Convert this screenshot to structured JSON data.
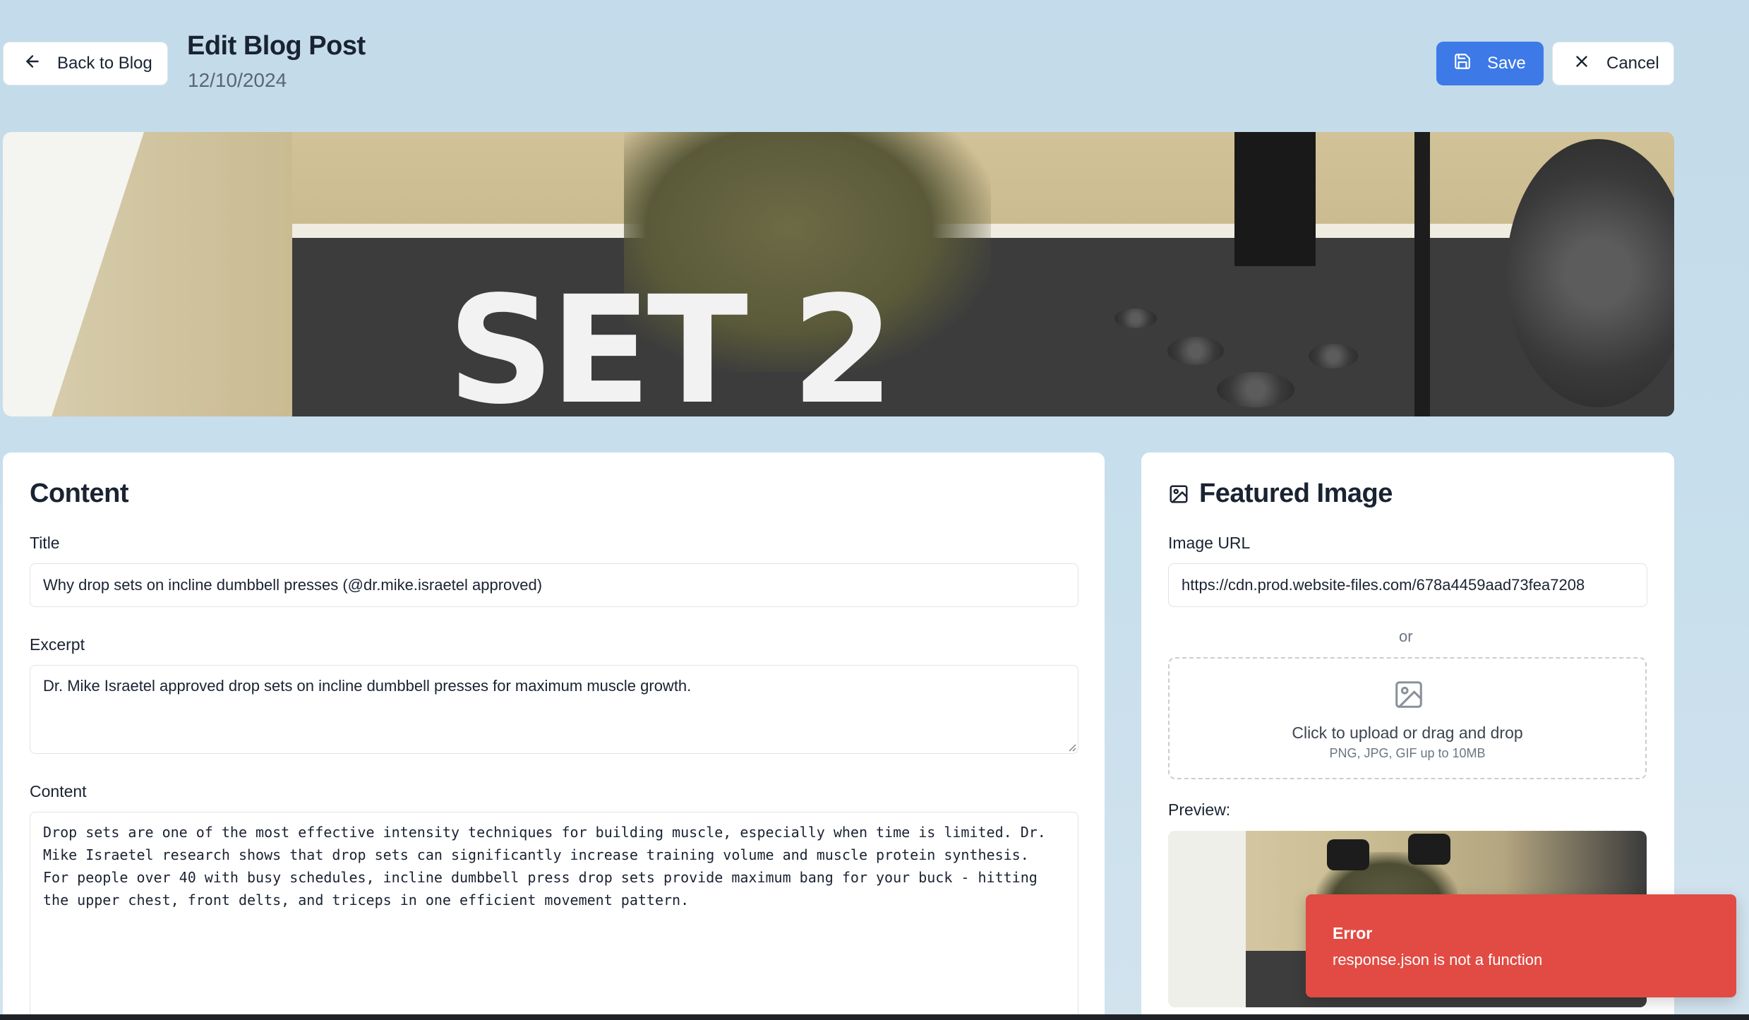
{
  "header": {
    "back_label": "Back to Blog",
    "title": "Edit Blog Post",
    "date": "12/10/2024",
    "save_label": "Save",
    "cancel_label": "Cancel"
  },
  "hero": {
    "overlay_text": "SET 2"
  },
  "content_card": {
    "title": "Content",
    "title_label": "Title",
    "title_value": "Why drop sets on incline dumbbell presses (@dr.mike.israetel approved)",
    "excerpt_label": "Excerpt",
    "excerpt_value": "Dr. Mike Israetel approved drop sets on incline dumbbell presses for maximum muscle growth.",
    "content_label": "Content",
    "content_value": "Drop sets are one of the most effective intensity techniques for building muscle, especially when time is limited. Dr.\nMike Israetel research shows that drop sets can significantly increase training volume and muscle protein synthesis.\nFor people over 40 with busy schedules, incline dumbbell press drop sets provide maximum bang for your buck - hitting\nthe upper chest, front delts, and triceps in one efficient movement pattern."
  },
  "image_card": {
    "title": "Featured Image",
    "url_label": "Image URL",
    "url_value": "https://cdn.prod.website-files.com/678a4459aad73fea7208",
    "or_text": "or",
    "upload_main": "Click to upload or drag and drop",
    "upload_sub": "PNG, JPG, GIF up to 10MB",
    "preview_label": "Preview:"
  },
  "toast": {
    "title": "Error",
    "message": "response.json is not a function"
  },
  "colors": {
    "accent": "#3d7ae8",
    "error": "#e14b43",
    "background": "#c3dbea"
  },
  "icons": [
    "arrow-left-icon",
    "save-icon",
    "close-icon",
    "image-icon",
    "image-upload-icon"
  ]
}
